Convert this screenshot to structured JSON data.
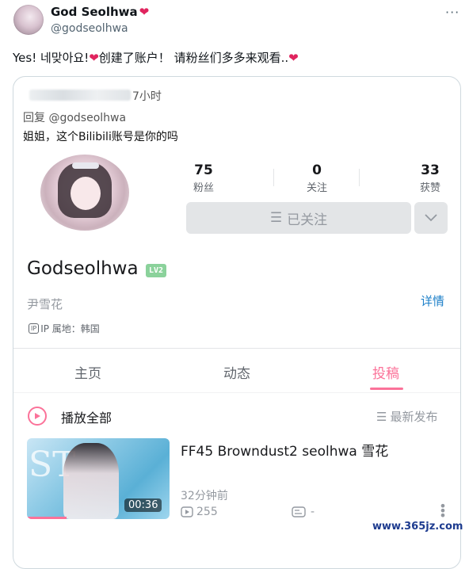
{
  "tweet": {
    "display_name": "God Seolhwa",
    "handle": "@godseolhwa",
    "text_part1": "Yes! 네맞아요!",
    "text_part2": " 创建了账户！ 请粉丝们多多来观看..",
    "more_label": "···"
  },
  "embed": {
    "time_ago": "7小时",
    "reply_to": "回复 @godseolhwa",
    "reply_text": "姐姐，这个Bilibili账号是你的吗",
    "stats": [
      {
        "value": "75",
        "label": "粉丝"
      },
      {
        "value": "0",
        "label": "关注"
      },
      {
        "value": "33",
        "label": "获赞"
      }
    ],
    "follow_button": "已关注",
    "username": "Godseolhwa",
    "level": "LV2",
    "real_name": "尹雪花",
    "details_link": "详情",
    "ip_badge": "IP",
    "ip_location": "IP 属地：韩国",
    "tabs": [
      "主页",
      "动态",
      "投稿"
    ],
    "active_tab": "投稿",
    "play_all": "播放全部",
    "sort_label": "最新发布",
    "video": {
      "title": "FF45 Browndust2 seolhwa 雪花",
      "duration": "00:36",
      "posted": "32分钟前",
      "views": "255",
      "danmaku": "-",
      "progress": 0.28
    }
  },
  "watermark": "www.365jz.com",
  "colors": {
    "accent_pink": "#fb7299",
    "link_blue": "#1e80c9",
    "heart_red": "#e0245e",
    "level_green": "#8bd29b"
  }
}
